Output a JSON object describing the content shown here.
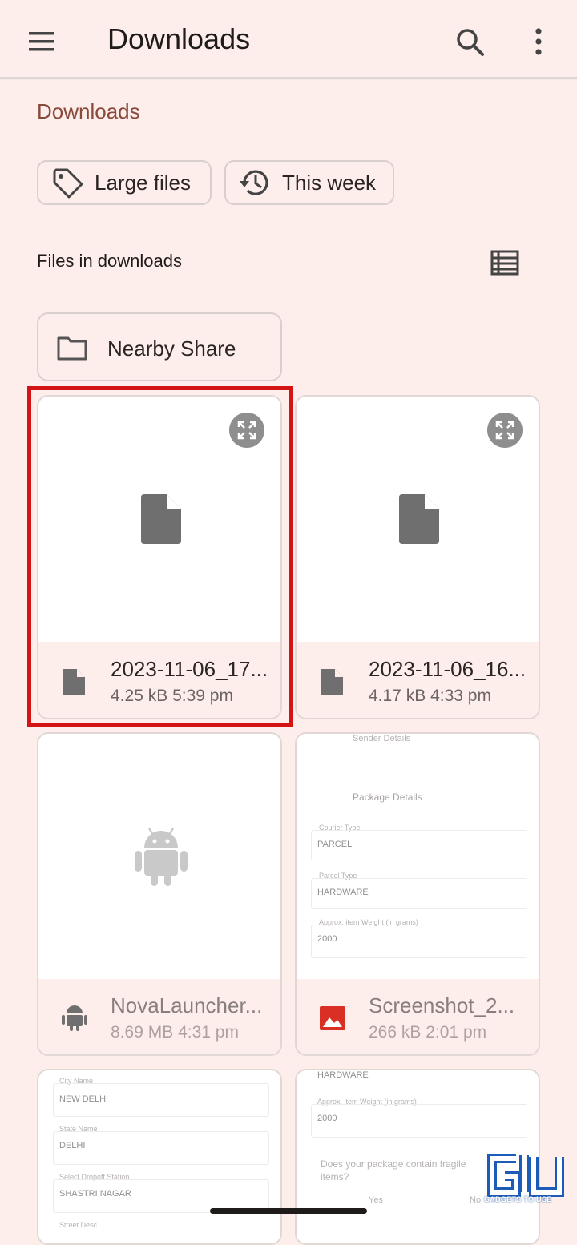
{
  "appbar": {
    "title": "Downloads",
    "menu_icon": "hamburger-menu-icon",
    "search_icon": "search-icon",
    "more_icon": "more-vert-icon"
  },
  "breadcrumb": "Downloads",
  "chips": [
    {
      "label": "Large files",
      "icon": "tag-icon"
    },
    {
      "label": "This week",
      "icon": "history-icon"
    }
  ],
  "section_title": "Files in downloads",
  "view_toggle_icon": "list-view-icon",
  "folder": {
    "label": "Nearby Share",
    "icon": "folder-icon"
  },
  "files": [
    {
      "name": "2023-11-06_17...",
      "size": "4.25 kB",
      "time": "5:39 pm",
      "type": "document",
      "highlighted": true
    },
    {
      "name": "2023-11-06_16...",
      "size": "4.17 kB",
      "time": "4:33 pm",
      "type": "document",
      "highlighted": false
    },
    {
      "name": "NovaLauncher...",
      "size": "8.69 MB",
      "time": "4:31 pm",
      "type": "apk",
      "highlighted": false
    },
    {
      "name": "Screenshot_2...",
      "size": "266 kB",
      "time": "2:01 pm",
      "type": "image",
      "highlighted": false
    }
  ],
  "screenshot_preview_1": {
    "sender_details": "Sender Details",
    "package_details": "Package Details",
    "courier_type_label": "Courier Type",
    "courier_type_value": "PARCEL",
    "parcel_type_label": "Parcel Type",
    "parcel_type_value": "HARDWARE",
    "weight_label": "Approx. item Weight (in grams)",
    "weight_value": "2000"
  },
  "screenshot_preview_2": {
    "city_label": "City Name",
    "city_value": "NEW DELHI",
    "state_label": "State Name",
    "state_value": "DELHI",
    "dropoff_label": "Select Dropoff Station",
    "dropoff_value": "SHASTRI NAGAR",
    "street_label": "Street Desc"
  },
  "screenshot_preview_3": {
    "top_value": "HARDWARE",
    "weight_label": "Approx. item Weight (in grams)",
    "weight_value": "2000",
    "question": "Does your package contain fragile",
    "question_2": "items?",
    "yes": "Yes",
    "no": "No"
  },
  "watermark": {
    "text": "GADGETS TO USE"
  },
  "colors": {
    "background": "#fdeeec",
    "accent_breadcrumb": "#8a4a3a",
    "highlight_border": "#d41414",
    "image_icon": "#d93025"
  }
}
